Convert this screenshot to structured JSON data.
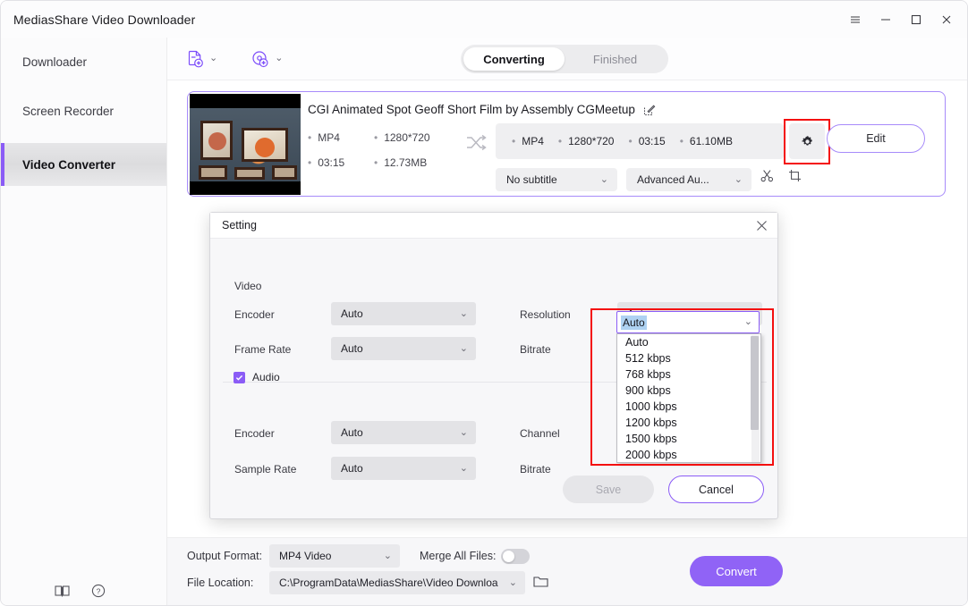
{
  "window": {
    "title": "MediasShare Video Downloader",
    "controls": [
      {
        "name": "menu-icon",
        "label": "☰"
      },
      {
        "name": "minimize-icon",
        "label": "—"
      },
      {
        "name": "maximize-icon",
        "label": "□"
      },
      {
        "name": "close-icon",
        "label": "✕"
      }
    ]
  },
  "sidebar": {
    "items": [
      {
        "label": "Downloader",
        "active": false
      },
      {
        "label": "Screen Recorder",
        "active": false
      },
      {
        "label": "Video Converter",
        "active": true
      }
    ],
    "bottom_icons": [
      {
        "name": "guide-book-icon"
      },
      {
        "name": "help-circle-icon"
      }
    ]
  },
  "toolbar": {
    "add_file_icon": "add-file-icon",
    "add_disc_icon": "add-disc-icon",
    "chevron": "⌄",
    "tabs": [
      {
        "label": "Converting",
        "active": true
      },
      {
        "label": "Finished",
        "active": false
      }
    ]
  },
  "task": {
    "title": "CGI Animated Spot Geoff Short Film by Assembly  CGMeetup",
    "edit_title_icon": "edit-pencil-icon",
    "source": {
      "format": "MP4",
      "resolution": "1280*720",
      "duration": "03:15",
      "size": "12.73MB"
    },
    "swap_icon": "shuffle-arrows-icon",
    "output": {
      "format": "MP4",
      "resolution": "1280*720",
      "duration": "03:15",
      "size": "61.10MB"
    },
    "gear_icon": "settings-gear-icon",
    "edit_button": "Edit",
    "subtitle_select": "No subtitle",
    "audio_select": "Advanced Au...",
    "trim_icon": "scissors-icon",
    "crop_icon": "crop-icon"
  },
  "dialog": {
    "title": "Setting",
    "close_icon": "✕",
    "video_section": "Video",
    "fields": {
      "encoder_label": "Encoder",
      "encoder_value": "Auto",
      "resolution_label": "Resolution",
      "resolution_value": "Auto",
      "frame_rate_label": "Frame Rate",
      "frame_rate_value": "Auto",
      "bitrate_label": "Bitrate",
      "bitrate_value": "Auto"
    },
    "audio": {
      "checkbox_label": "Audio",
      "checked": true,
      "encoder_label": "Encoder",
      "encoder_value": "Auto",
      "channel_label": "Channel",
      "sample_rate_label": "Sample Rate",
      "sample_rate_value": "Auto",
      "bitrate_label": "Bitrate"
    },
    "bitrate_dropdown": {
      "selected": "Auto",
      "options": [
        "Auto",
        "512 kbps",
        "768 kbps",
        "900 kbps",
        "1000 kbps",
        "1200 kbps",
        "1500 kbps",
        "2000 kbps"
      ]
    },
    "save_button": "Save",
    "cancel_button": "Cancel"
  },
  "bottom": {
    "output_format_label": "Output Format:",
    "output_format_value": "MP4 Video",
    "merge_label": "Merge All Files:",
    "merge_on": false,
    "file_location_label": "File Location:",
    "file_location_value": "C:\\ProgramData\\MediasShare\\Video Downloa",
    "folder_icon": "folder-icon",
    "convert_button": "Convert"
  },
  "colors": {
    "accent": "#8b5cf6",
    "convert": "#9063f6",
    "highlight_box": "#f40f0f",
    "selection": "#aed2f2"
  }
}
